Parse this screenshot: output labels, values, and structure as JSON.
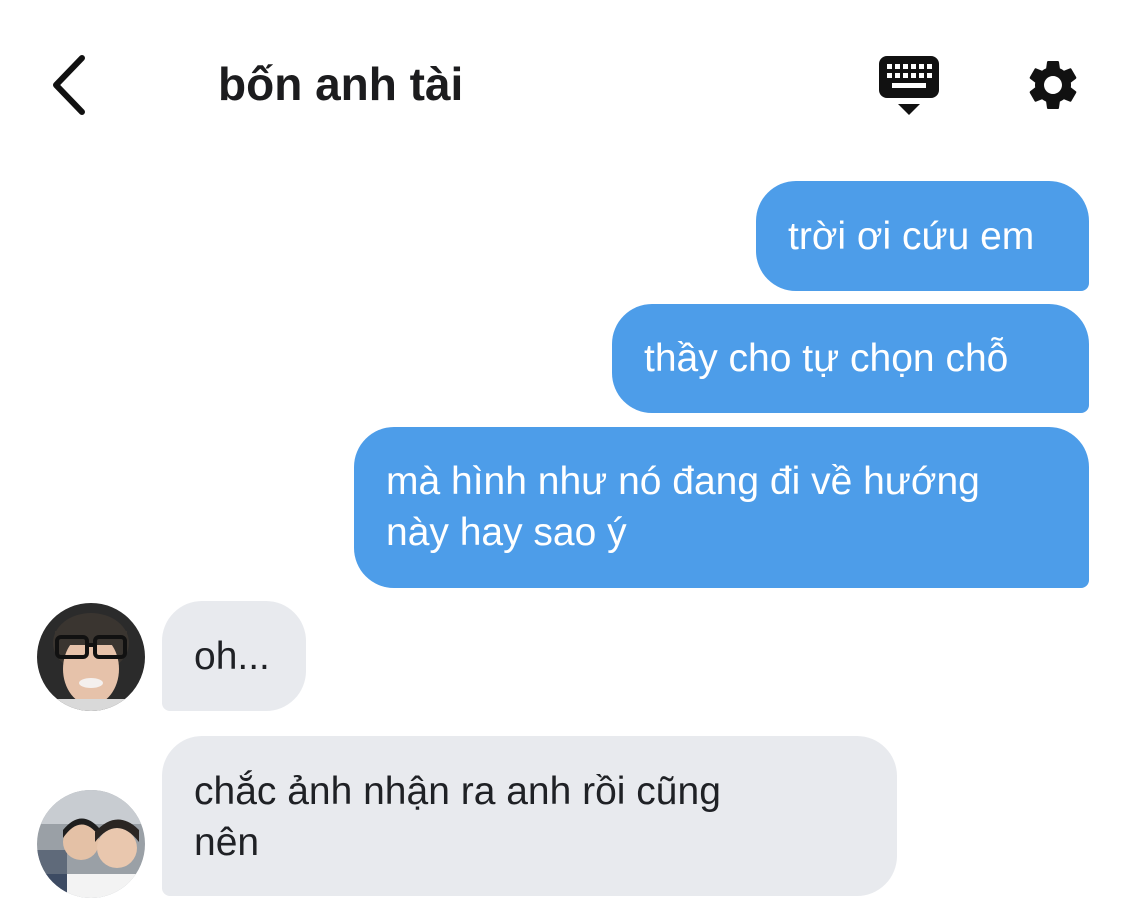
{
  "header": {
    "title": "bốn anh tài",
    "back_icon": "chevron-left-icon",
    "keyboard_icon": "keyboard-icon",
    "settings_icon": "gear-icon"
  },
  "messages": [
    {
      "direction": "outgoing",
      "lines": [
        "trời ơi cứu em"
      ]
    },
    {
      "direction": "outgoing",
      "lines": [
        "thầy cho tự chọn chỗ"
      ]
    },
    {
      "direction": "outgoing",
      "lines": [
        "mà hình như nó đang đi về hướng",
        "này hay sao ý"
      ]
    },
    {
      "direction": "incoming",
      "lines": [
        "oh..."
      ]
    },
    {
      "direction": "incoming",
      "lines": [
        "chắc ảnh nhận ra anh rồi cũng",
        "nên"
      ]
    }
  ],
  "colors": {
    "outgoing_bubble": "#4d9de9",
    "incoming_bubble": "#e8eaee",
    "text_dark": "#1c1c1e"
  }
}
